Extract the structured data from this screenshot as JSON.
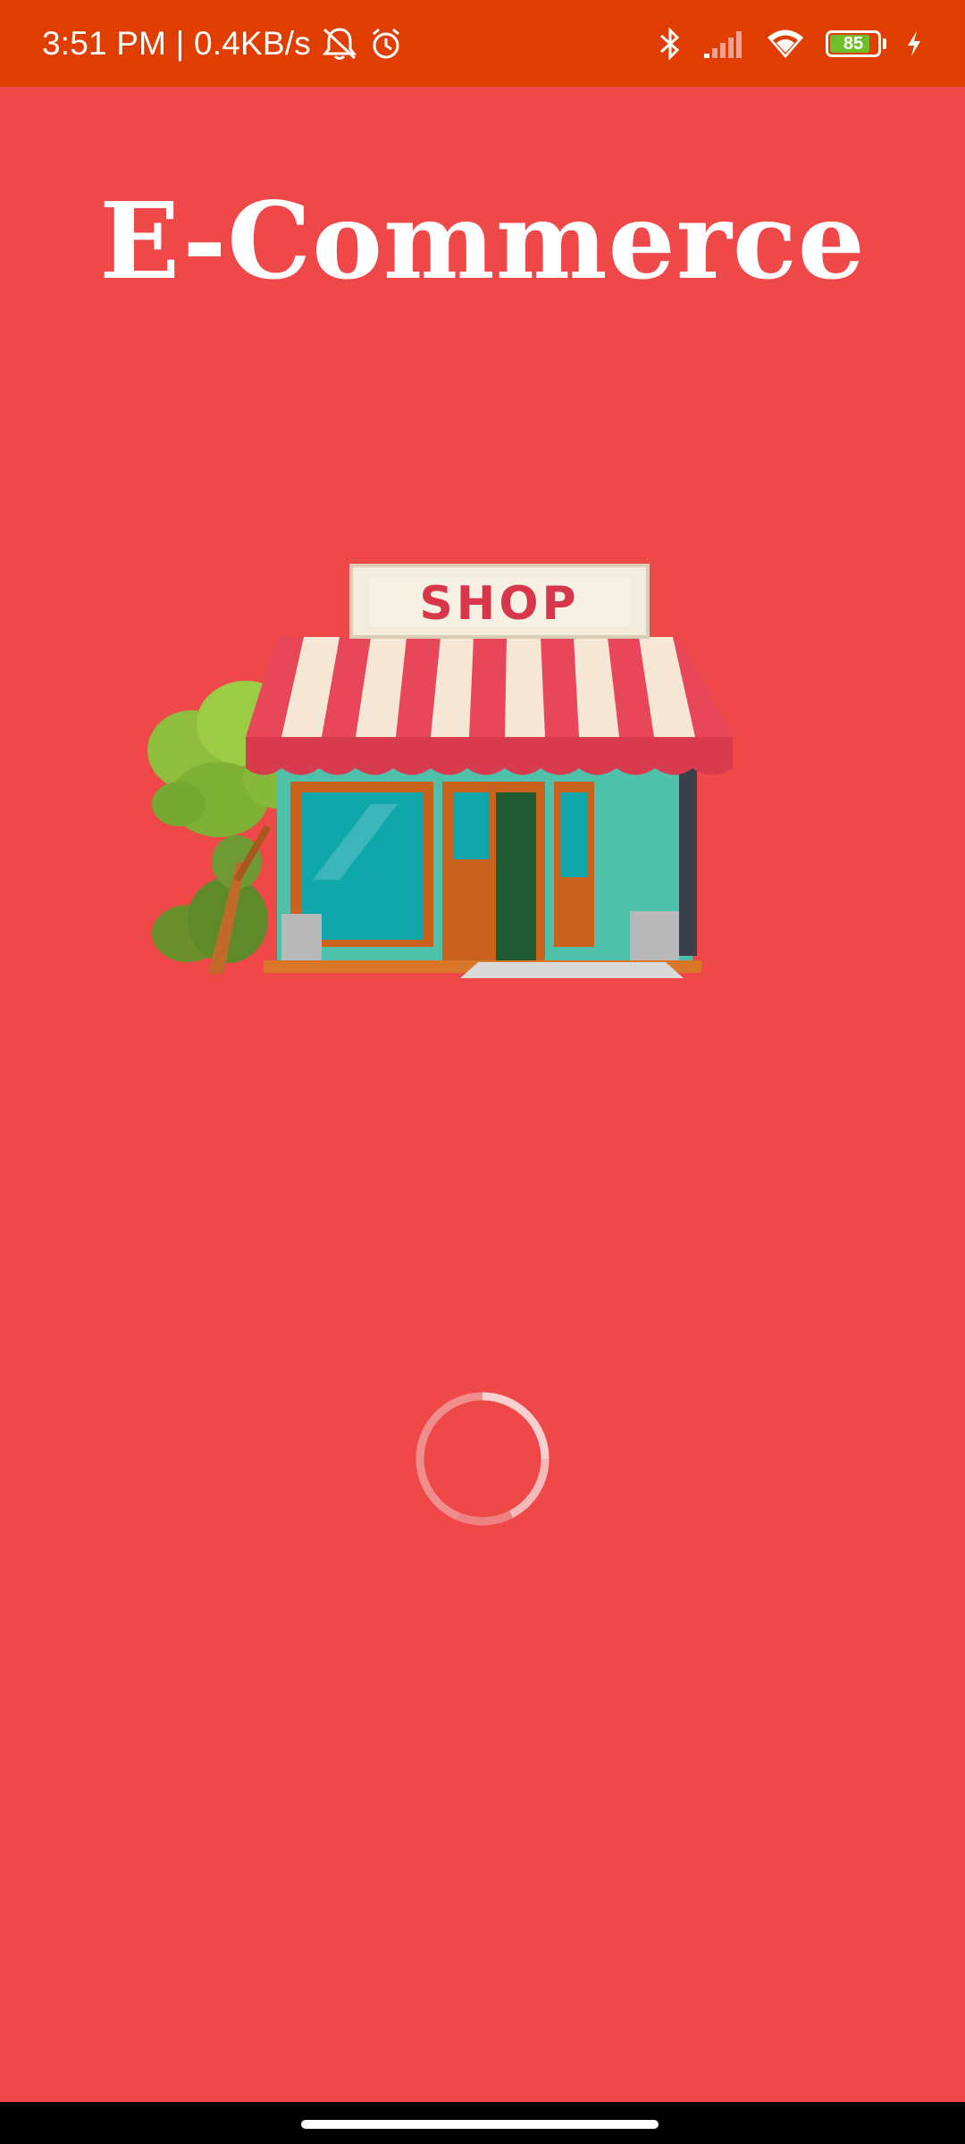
{
  "status_bar": {
    "time_network": "3:51 PM | 0.4KB/s",
    "battery_level": "85",
    "battery_fraction": 0.85,
    "icons": [
      "mute-notifications-icon",
      "alarm-icon",
      "bluetooth-icon",
      "signal-icon",
      "wifi-icon",
      "battery-icon",
      "charging-icon"
    ]
  },
  "app": {
    "title": "E-Commerce",
    "illustration_sign": "SHOP"
  },
  "colors": {
    "background": "#ef4848",
    "status_bar": "#e03e00",
    "title_text": "#ffffff"
  },
  "loading": {
    "indicator": "circular-progress-spinner"
  }
}
